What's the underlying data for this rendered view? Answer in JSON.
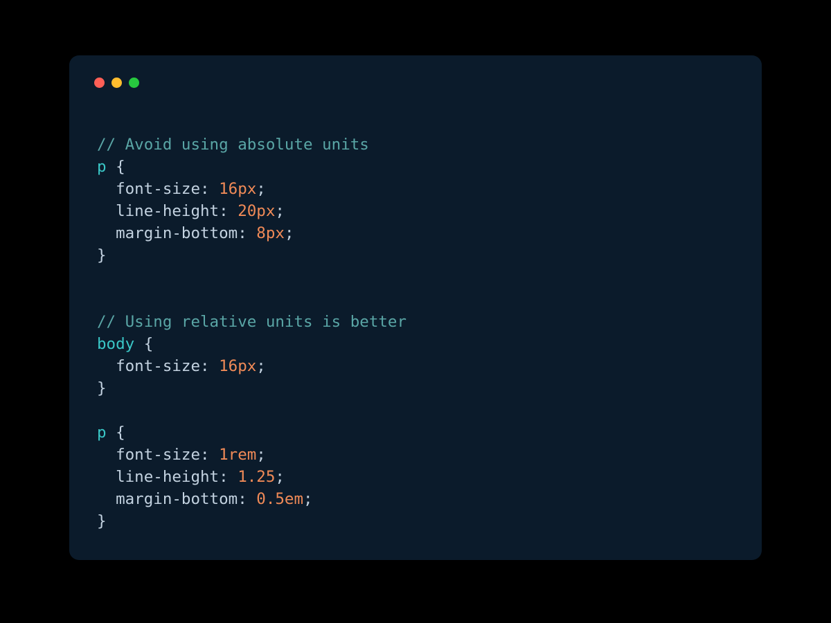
{
  "traffic": {
    "red_title": "close",
    "yellow_title": "minimize",
    "green_title": "maximize"
  },
  "code": {
    "comment1": "// Avoid using absolute units",
    "sel_p1": "p",
    "brace_open": " {",
    "indent": "  ",
    "prop_fs": "font-size",
    "colon": ":",
    "space": " ",
    "semi": ";",
    "val_16px": "16px",
    "prop_lh": "line-height",
    "val_20px": "20px",
    "prop_mb": "margin-bottom",
    "val_8px": "8px",
    "brace_close": "}",
    "blank": "",
    "comment2": "// Using relative units is better",
    "sel_body": "body",
    "val_16px_2": "16px",
    "sel_p2": "p",
    "val_1rem": "1rem",
    "val_125": "1.25",
    "val_05em": "0.5em"
  }
}
